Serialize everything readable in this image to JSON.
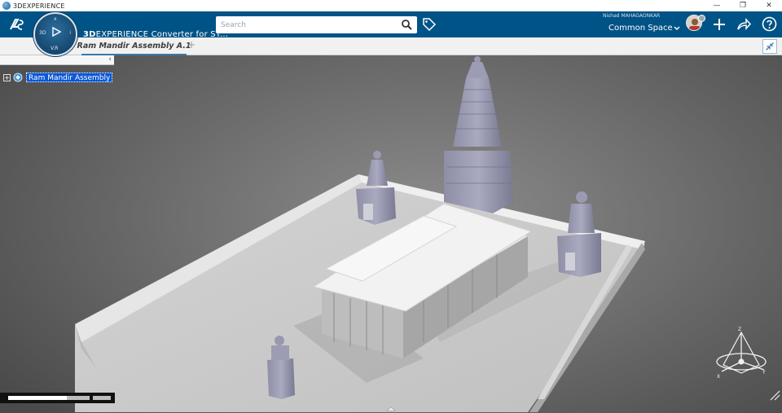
{
  "window": {
    "title": "3DEXPERIENCE",
    "minimize": "—",
    "restore": "❐",
    "close": "✕"
  },
  "topbar": {
    "compass": {
      "north": "x",
      "west": "3D",
      "east": "i",
      "south": "V.R"
    },
    "app_title_brand": "3D",
    "app_title_rest": "EXPERIENCE Converter for ST...",
    "search": {
      "placeholder": "Search",
      "value": ""
    },
    "user": {
      "name": "Nishad MAHAGAONKAR",
      "space": "Common Space"
    }
  },
  "tabs": [
    {
      "label": "Ram Mandir Assembly A.1",
      "active": true
    }
  ],
  "tab_add": "+",
  "tree": {
    "collapse": "‹",
    "root": {
      "expander": "+",
      "label": "Ram Mandir Assembly"
    }
  },
  "viewport": {
    "axes": {
      "x": "X",
      "y": "Y",
      "z": "Z"
    }
  },
  "progress": {
    "fraction": 0.72
  },
  "colors": {
    "topbar": "#005386",
    "selection": "#0a58d6",
    "tab_underline": "#3a78ab"
  }
}
